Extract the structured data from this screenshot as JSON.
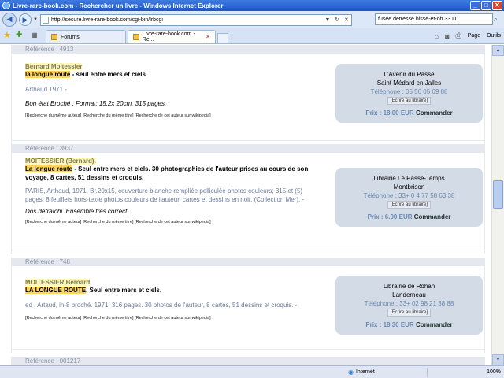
{
  "window": {
    "title": "Livre-rare-book.com - Rechercher un livre - Windows Internet Explorer"
  },
  "address": {
    "url": "http://secure.livre-rare-book.com/cgi-bin/lrbcgi"
  },
  "search": {
    "value": "fusée detresse hisse-et-oh 33.D"
  },
  "tabs": [
    {
      "label": "Forums"
    },
    {
      "label": "Livre-rare-book.com - Re..."
    }
  ],
  "toolbar": {
    "page_label": "Page",
    "tools_label": "Outils"
  },
  "listings": [
    {
      "reference": "Référence : 4913",
      "author": "Bernard Moitessier",
      "title": "la longue route",
      "title_rest": " - seul entre mers et ciels",
      "publication": "Arthaud 1971  -",
      "description": "Bon état Broché . Format: 15,2x 20cm. 315 pages.",
      "links": "[Recherche du même auteur] [Recherche du même titre] [Recherche de cet auteur sur wikipedia]",
      "seller": {
        "name": "L'Avenir du Passé",
        "city": "Saint Médard en Jalles",
        "phone": "Téléphone : 05 56 05 69 88",
        "mail": "[Ecrire au libraire]",
        "price": "Prix : 18.00 EUR",
        "order": "Commander"
      }
    },
    {
      "reference": "Référence : 3937",
      "author": "MOITESSIER (Bernard).",
      "title": "La longue route",
      "title_rest": " - Seul entre mers et ciels. 30 photographies de l'auteur prises au cours de son voyage, 8 cartes, 51 dessins et croquis.",
      "publication": "PARIS, Arthaud, 1971, Br.20x15, couverture blanche rempliée pelliculée photos couleurs; 315 et (5) pages; 8 feuillets hors-texte photos couleurs de l'auteur, cartes et dessins en noir. (Collection Mer).  -",
      "description": "Dos défraîchi. Ensemble très correct.",
      "links": "[Recherche du même auteur] [Recherche du même titre] [Recherche de cet auteur sur wikipedia]",
      "seller": {
        "name": "Librairie Le Passe-Temps",
        "city": "Montbrison",
        "phone": "Téléphone : 33+ 0 4 77 58 63 38",
        "mail": "[Ecrire au libraire]",
        "price": "Prix : 6.00 EUR",
        "order": "Commander"
      }
    },
    {
      "reference": "Référence : 748",
      "author": "MOITESSIER Bernard",
      "title": "LA LONGUE ROUTE",
      "title_rest": ". Seul entre mers et ciels.",
      "publication": "ed : Artaud, in-8 broché. 1971. 316 pages. 30 photos de l'auteur, 8 cartes, 51 dessins et croquis.  -",
      "description": "",
      "links": "[Recherche du même auteur] [Recherche du même titre] [Recherche de cet auteur sur wikipedia]",
      "seller": {
        "name": "Librairie de Rohan",
        "city": "Landerneau",
        "phone": "Téléphone : 33+ 02 98 21 38 88",
        "mail": "[Ecrire au libraire]",
        "price": "Prix : 18.30 EUR",
        "order": "Commander"
      }
    }
  ],
  "next_reference": "Référence : 001217",
  "status": {
    "zone": "Internet",
    "zoom": "100%"
  },
  "colors": {
    "titlebar": "#1f55c8",
    "highlight": "#fff6b8",
    "seller_box": "#d3dbe6",
    "ref_bar": "#e5e8ee"
  }
}
